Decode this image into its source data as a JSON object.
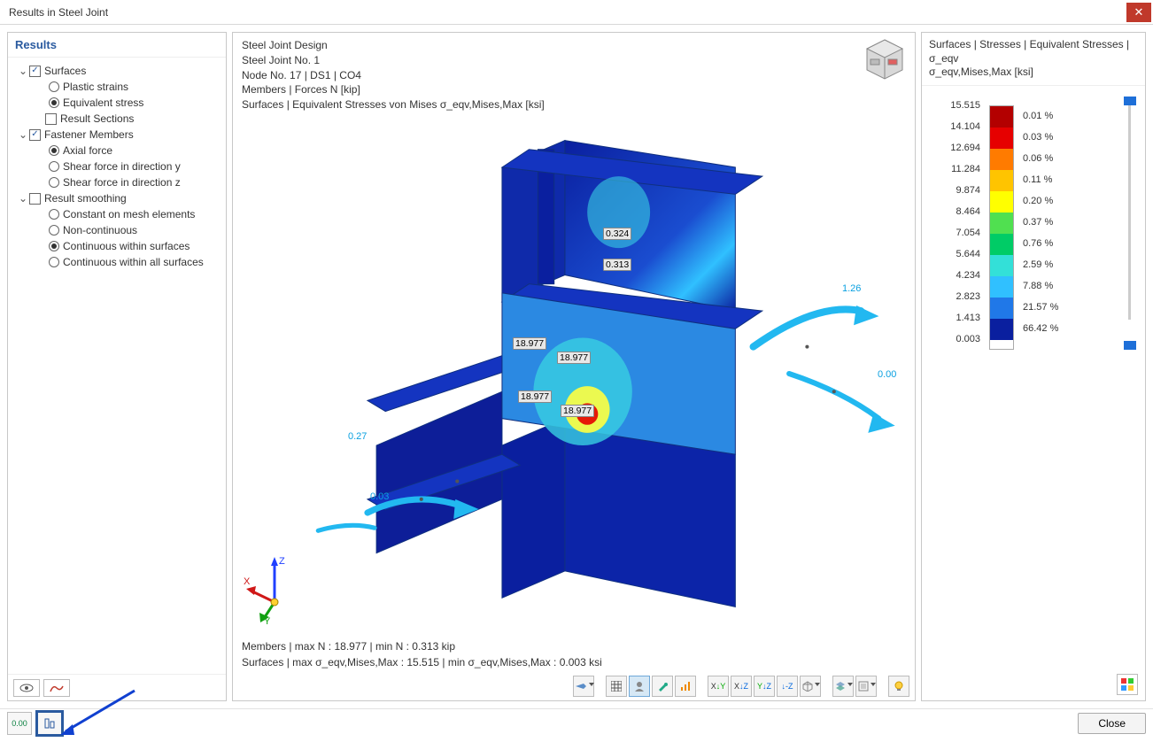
{
  "window": {
    "title": "Results in Steel Joint"
  },
  "sidebar": {
    "header": "Results",
    "items": [
      {
        "type": "group",
        "expanded": true,
        "checkbox": true,
        "checked": true,
        "label": "Surfaces"
      },
      {
        "type": "radio",
        "indent": 2,
        "selected": false,
        "label": "Plastic strains"
      },
      {
        "type": "radio",
        "indent": 2,
        "selected": true,
        "label": "Equivalent stress"
      },
      {
        "type": "check",
        "indent": 1,
        "checked": false,
        "label": "Result Sections"
      },
      {
        "type": "group",
        "expanded": true,
        "checkbox": true,
        "checked": true,
        "label": "Fastener Members"
      },
      {
        "type": "radio",
        "indent": 2,
        "selected": true,
        "label": "Axial force"
      },
      {
        "type": "radio",
        "indent": 2,
        "selected": false,
        "label": "Shear force in direction y"
      },
      {
        "type": "radio",
        "indent": 2,
        "selected": false,
        "label": "Shear force in direction z"
      },
      {
        "type": "group",
        "expanded": true,
        "checkbox": true,
        "checked": false,
        "label": "Result smoothing"
      },
      {
        "type": "radio",
        "indent": 2,
        "selected": false,
        "label": "Constant on mesh elements"
      },
      {
        "type": "radio",
        "indent": 2,
        "selected": false,
        "label": "Non-continuous"
      },
      {
        "type": "radio",
        "indent": 2,
        "selected": true,
        "label": "Continuous within surfaces"
      },
      {
        "type": "radio",
        "indent": 2,
        "selected": false,
        "label": "Continuous within all surfaces"
      }
    ]
  },
  "viewport": {
    "info": [
      "Steel Joint Design",
      "Steel Joint No. 1",
      "Node No. 17 | DS1 | CO4",
      "Members | Forces N [kip]",
      "Surfaces | Equivalent Stresses von Mises σ_eqv,Mises,Max [ksi]"
    ],
    "bottom": [
      "Members | max N : 18.977 | min N : 0.313 kip",
      "Surfaces | max σ_eqv,Mises,Max : 15.515 | min σ_eqv,Mises,Max : 0.003 ksi"
    ],
    "labels": {
      "l1": "0.324",
      "l2": "0.313",
      "l3": "18.977",
      "l4": "18.977",
      "l5": "18.977",
      "l6": "18.977"
    },
    "forces": {
      "f1": "1.26",
      "f2": "0.00",
      "f3": "0.27",
      "f4": "0.03"
    },
    "axes": {
      "x": "X",
      "y": "Y",
      "z": "Z"
    },
    "toolbar": [
      "fly",
      "grid",
      "user",
      "tool",
      "graph",
      "xy",
      "xz",
      "yz",
      "-z",
      "iso",
      "layers",
      "render",
      "cam",
      "bulb"
    ]
  },
  "legend": {
    "title1": "Surfaces | Stresses | Equivalent Stresses | σ_eqv",
    "title2": "σ_eqv,Mises,Max [ksi]",
    "rows": [
      {
        "val": "15.515",
        "color": "#b30000",
        "pct": "0.01 %"
      },
      {
        "val": "14.104",
        "color": "#e60000",
        "pct": "0.03 %"
      },
      {
        "val": "12.694",
        "color": "#ff7b00",
        "pct": "0.06 %"
      },
      {
        "val": "11.284",
        "color": "#ffc400",
        "pct": "0.11 %"
      },
      {
        "val": "9.874",
        "color": "#ffff00",
        "pct": "0.20 %"
      },
      {
        "val": "8.464",
        "color": "#50e050",
        "pct": "0.37 %"
      },
      {
        "val": "7.054",
        "color": "#00cc66",
        "pct": "0.76 %"
      },
      {
        "val": "5.644",
        "color": "#33e0d8",
        "pct": "2.59 %"
      },
      {
        "val": "4.234",
        "color": "#30c0ff",
        "pct": "7.88 %"
      },
      {
        "val": "2.823",
        "color": "#2078e8",
        "pct": "21.57 %"
      },
      {
        "val": "1.413",
        "color": "#0a1f9f",
        "pct": "66.42 %"
      },
      {
        "val": "0.003",
        "color": "",
        "pct": ""
      }
    ]
  },
  "footer": {
    "close": "Close"
  }
}
